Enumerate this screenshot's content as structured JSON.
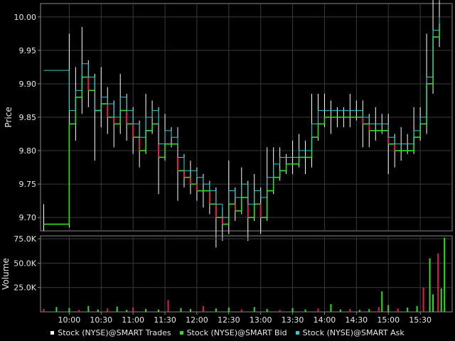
{
  "colors": {
    "background": "#000000",
    "panel_border": "#8a8a8a",
    "grid": "#3a3a3a",
    "text": "#e8e8e8",
    "trades": "#ffffff",
    "bid": "#33dd22",
    "ask": "#33cccc",
    "down": "#e0204a",
    "volume_up": "#33dd22",
    "volume_down": "#e0204a"
  },
  "chart_data": [
    {
      "type": "line",
      "ylabel": "Price",
      "ylim": [
        9.68,
        10.02
      ],
      "y_ticks": [
        "9.70",
        "9.75",
        "9.80",
        "9.85",
        "9.90",
        "9.95",
        "10.00"
      ],
      "grid": true,
      "x_ticks": [
        "10:00",
        "10:30",
        "11:00",
        "11:30",
        "12:00",
        "12:30",
        "13:00",
        "13:30",
        "14:00",
        "14:30",
        "15:00",
        "15:30"
      ],
      "x_minutes": [
        9.6,
        10.0,
        10.1,
        10.2,
        10.3,
        10.4,
        10.5,
        10.6,
        10.7,
        10.8,
        10.9,
        11.0,
        11.1,
        11.2,
        11.3,
        11.4,
        11.5,
        11.6,
        11.7,
        11.8,
        11.9,
        12.0,
        12.1,
        12.2,
        12.3,
        12.4,
        12.5,
        12.6,
        12.7,
        12.8,
        12.9,
        13.0,
        13.1,
        13.2,
        13.3,
        13.4,
        13.5,
        13.6,
        13.7,
        13.8,
        13.9,
        14.0,
        14.1,
        14.2,
        14.3,
        14.4,
        14.5,
        14.6,
        14.7,
        14.8,
        14.9,
        15.0,
        15.1,
        15.2,
        15.3,
        15.4,
        15.5,
        15.6,
        15.7,
        15.8
      ],
      "series": [
        {
          "name": "Stock (NYSE)@SMART Trades",
          "values": [
            9.7,
            9.83,
            9.87,
            9.92,
            9.9,
            9.85,
            9.88,
            9.86,
            9.84,
            9.87,
            9.85,
            9.83,
            9.81,
            9.84,
            9.85,
            9.8,
            9.82,
            9.82,
            9.78,
            9.77,
            9.76,
            9.75,
            9.74,
            9.73,
            9.7,
            9.69,
            9.73,
            9.72,
            9.74,
            9.71,
            9.73,
            9.71,
            9.75,
            9.77,
            9.78,
            9.78,
            9.79,
            9.8,
            9.79,
            9.83,
            9.85,
            9.86,
            9.85,
            9.85,
            9.85,
            9.86,
            9.86,
            9.84,
            9.83,
            9.84,
            9.84,
            9.81,
            9.8,
            9.81,
            9.81,
            9.83,
            9.84,
            9.9,
            9.97,
            9.99
          ]
        },
        {
          "name": "Stock (NYSE)@SMART Bid",
          "values": [
            9.69,
            9.84,
            9.88,
            9.91,
            9.89,
            9.86,
            9.87,
            9.85,
            9.84,
            9.86,
            9.84,
            9.82,
            9.8,
            9.83,
            9.84,
            9.79,
            9.81,
            9.81,
            9.77,
            9.76,
            9.75,
            9.74,
            9.74,
            9.72,
            9.7,
            9.69,
            9.72,
            9.71,
            9.73,
            9.7,
            9.72,
            9.7,
            9.74,
            9.76,
            9.77,
            9.78,
            9.78,
            9.79,
            9.79,
            9.82,
            9.84,
            9.85,
            9.85,
            9.85,
            9.85,
            9.85,
            9.85,
            9.84,
            9.83,
            9.83,
            9.83,
            9.81,
            9.8,
            9.8,
            9.8,
            9.82,
            9.84,
            9.9,
            9.97,
            9.99
          ]
        },
        {
          "name": "Stock (NYSE)@SMART Ask",
          "values": [
            9.92,
            9.86,
            9.89,
            9.93,
            9.91,
            9.86,
            9.88,
            9.87,
            9.85,
            9.88,
            9.86,
            9.84,
            9.82,
            9.85,
            9.86,
            9.81,
            9.83,
            9.82,
            9.79,
            9.77,
            9.77,
            9.76,
            9.75,
            9.74,
            9.72,
            9.7,
            9.74,
            9.73,
            9.75,
            9.72,
            9.74,
            9.73,
            9.76,
            9.78,
            9.79,
            9.79,
            9.79,
            9.8,
            9.8,
            9.84,
            9.86,
            9.86,
            9.86,
            9.86,
            9.86,
            9.86,
            9.86,
            9.85,
            9.84,
            9.84,
            9.84,
            9.82,
            9.81,
            9.81,
            9.81,
            9.83,
            9.85,
            9.91,
            9.98,
            10.0
          ]
        }
      ]
    },
    {
      "type": "bar",
      "ylabel": "Volume",
      "ylim": [
        0,
        78000
      ],
      "y_ticks": [
        "25.0K",
        "50.0K",
        "75.0K"
      ],
      "grid": true,
      "x_ticks": [
        "10:00",
        "10:30",
        "11:00",
        "11:30",
        "12:00",
        "12:30",
        "13:00",
        "13:30",
        "14:00",
        "14:30",
        "15:00",
        "15:30"
      ],
      "volumes": [
        [
          9.6,
          3000
        ],
        [
          9.8,
          5000
        ],
        [
          10.0,
          4000
        ],
        [
          10.15,
          2000
        ],
        [
          10.3,
          6000
        ],
        [
          10.45,
          2500
        ],
        [
          10.6,
          3500
        ],
        [
          10.75,
          5500
        ],
        [
          10.9,
          2000
        ],
        [
          11.0,
          4500
        ],
        [
          11.2,
          3000
        ],
        [
          11.4,
          2500
        ],
        [
          11.55,
          12000
        ],
        [
          11.75,
          4000
        ],
        [
          11.9,
          3000
        ],
        [
          12.1,
          6000
        ],
        [
          12.3,
          3500
        ],
        [
          12.5,
          4500
        ],
        [
          12.7,
          2500
        ],
        [
          12.9,
          5000
        ],
        [
          13.1,
          3000
        ],
        [
          13.3,
          2000
        ],
        [
          13.5,
          4000
        ],
        [
          13.7,
          2500
        ],
        [
          13.9,
          3500
        ],
        [
          14.1,
          8000
        ],
        [
          14.25,
          2500
        ],
        [
          14.4,
          3000
        ],
        [
          14.55,
          2000
        ],
        [
          14.7,
          2800
        ],
        [
          14.85,
          5000
        ],
        [
          14.9,
          21000
        ],
        [
          15.0,
          7000
        ],
        [
          15.15,
          3500
        ],
        [
          15.3,
          4500
        ],
        [
          15.45,
          6000
        ],
        [
          15.55,
          25000
        ],
        [
          15.65,
          55000
        ],
        [
          15.7,
          18000
        ],
        [
          15.78,
          60000
        ],
        [
          15.83,
          24000
        ],
        [
          15.88,
          76000
        ]
      ]
    }
  ],
  "legend": {
    "trades": "Stock (NYSE)@SMART Trades",
    "bid": "Stock (NYSE)@SMART Bid",
    "ask": "Stock (NYSE)@SMART Ask"
  }
}
